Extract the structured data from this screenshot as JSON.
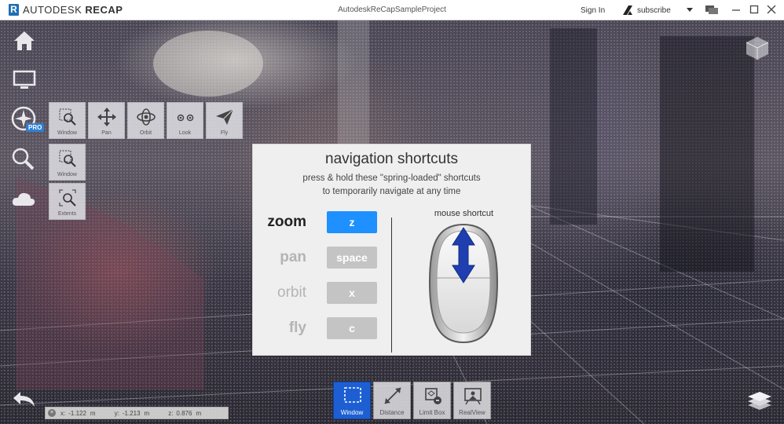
{
  "app": {
    "brand": "AUTODESK",
    "product": "RECAP",
    "project_title": "AutodeskReCapSampleProject",
    "sign_in": "Sign In",
    "subscribe": "subscribe"
  },
  "left_toolbar": {
    "pro_badge": "PRO",
    "nav_tools": [
      {
        "label": "Window"
      },
      {
        "label": "Pan"
      },
      {
        "label": "Orbit"
      },
      {
        "label": "Look"
      },
      {
        "label": "Fly"
      }
    ],
    "zoom_tools": [
      {
        "label": "Window"
      },
      {
        "label": "Extents"
      }
    ]
  },
  "shortcuts_dialog": {
    "title": "navigation shortcuts",
    "subtitle_line1": "press & hold these \"spring-loaded\" shortcuts",
    "subtitle_line2": "to temporarily navigate at any time",
    "shortcuts": [
      {
        "name": "zoom",
        "key": "z",
        "active": true
      },
      {
        "name": "pan",
        "key": "space",
        "active": false
      },
      {
        "name": "orbit",
        "key": "x",
        "active": false
      },
      {
        "name": "fly",
        "key": "c",
        "active": false
      }
    ],
    "mouse_title": "mouse shortcut"
  },
  "coordinates": {
    "x_label": "x:",
    "x_value": "-1.122",
    "y_label": "y:",
    "y_value": "-1.213",
    "z_label": "z:",
    "z_value": "0.876",
    "unit": "m"
  },
  "bottom_tools": [
    {
      "label": "Window",
      "active": true
    },
    {
      "label": "Distance",
      "active": false
    },
    {
      "label": "Limit Box",
      "active": false
    },
    {
      "label": "RealView",
      "active": false
    }
  ],
  "colors": {
    "accent": "#1e90ff",
    "active_tool": "#1d5fd3",
    "inactive_key": "#c4c4c4",
    "mouse_arrow": "#1f3fb0"
  }
}
